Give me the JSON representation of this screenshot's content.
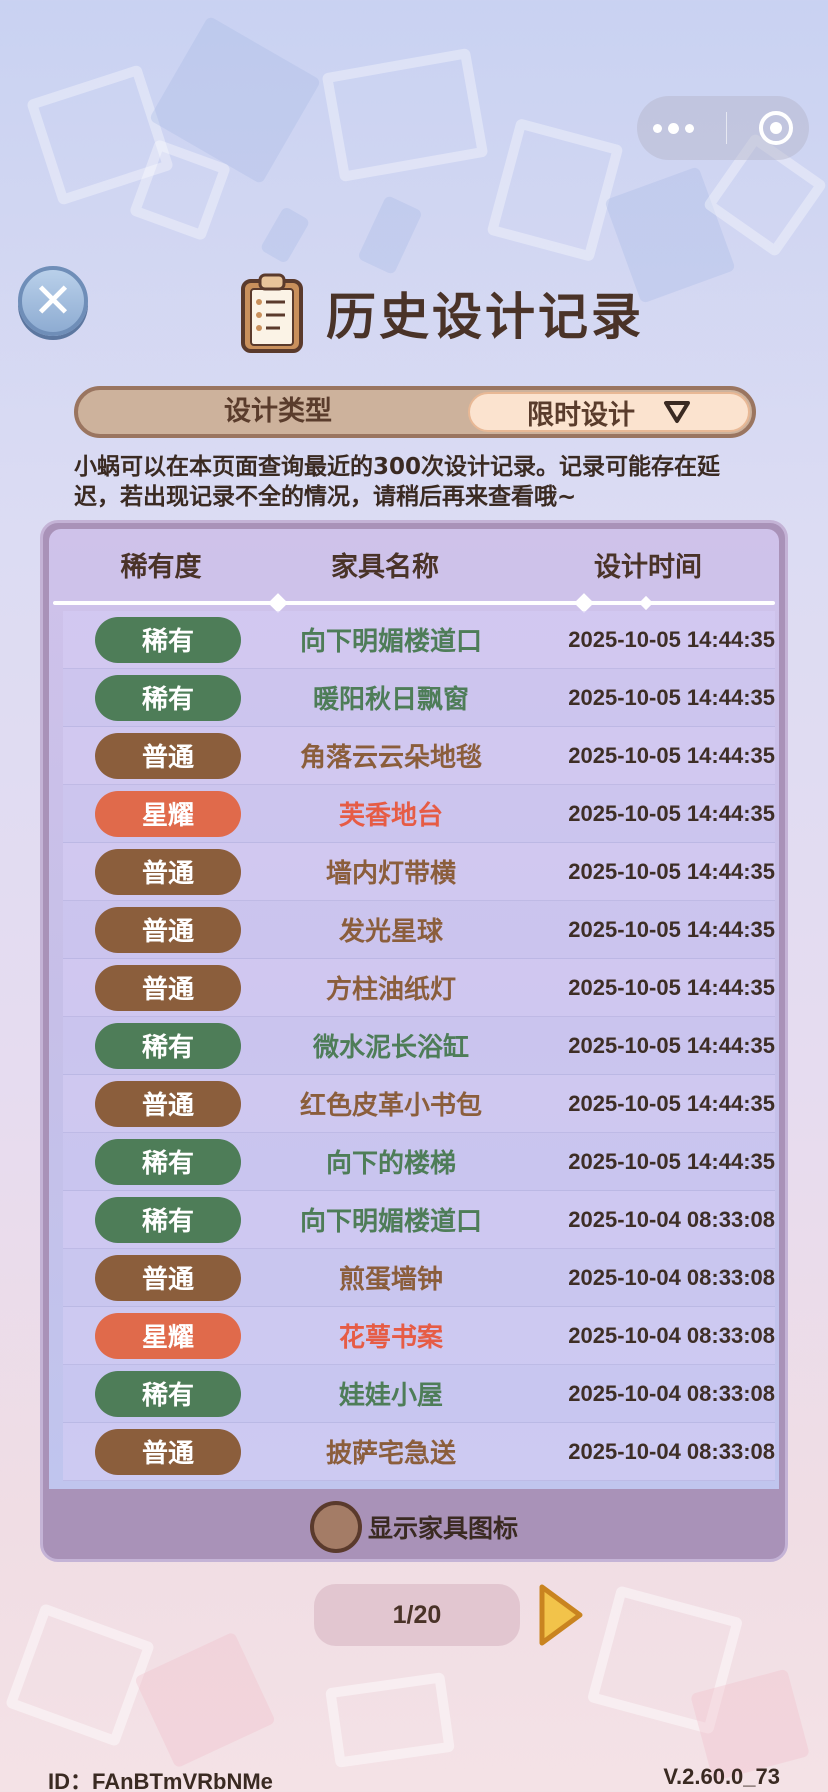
{
  "page": {
    "title": "历史设计记录",
    "type_label": "设计类型",
    "type_selected": "限时设计",
    "notice": "小蜗可以在本页面查询最近的300次设计记录。记录可能存在延迟，若出现记录不全的情况，请稍后再来查看哦~"
  },
  "table": {
    "headers": {
      "rarity": "稀有度",
      "name": "家具名称",
      "time": "设计时间"
    },
    "rows": [
      {
        "rarity": "稀有",
        "tier": "rare",
        "name": "向下明媚楼道口",
        "time": "2025-10-05 14:44:35"
      },
      {
        "rarity": "稀有",
        "tier": "rare",
        "name": "暖阳秋日飘窗",
        "time": "2025-10-05 14:44:35"
      },
      {
        "rarity": "普通",
        "tier": "common",
        "name": "角落云云朵地毯",
        "time": "2025-10-05 14:44:35"
      },
      {
        "rarity": "星耀",
        "tier": "star",
        "name": "芙香地台",
        "time": "2025-10-05 14:44:35"
      },
      {
        "rarity": "普通",
        "tier": "common",
        "name": "墙内灯带横",
        "time": "2025-10-05 14:44:35"
      },
      {
        "rarity": "普通",
        "tier": "common",
        "name": "发光星球",
        "time": "2025-10-05 14:44:35"
      },
      {
        "rarity": "普通",
        "tier": "common",
        "name": "方柱油纸灯",
        "time": "2025-10-05 14:44:35"
      },
      {
        "rarity": "稀有",
        "tier": "rare",
        "name": "微水泥长浴缸",
        "time": "2025-10-05 14:44:35"
      },
      {
        "rarity": "普通",
        "tier": "common",
        "name": "红色皮革小书包",
        "time": "2025-10-05 14:44:35"
      },
      {
        "rarity": "稀有",
        "tier": "rare",
        "name": "向下的楼梯",
        "time": "2025-10-05 14:44:35"
      },
      {
        "rarity": "稀有",
        "tier": "rare",
        "name": "向下明媚楼道口",
        "time": "2025-10-04 08:33:08"
      },
      {
        "rarity": "普通",
        "tier": "common",
        "name": "煎蛋墙钟",
        "time": "2025-10-04 08:33:08"
      },
      {
        "rarity": "星耀",
        "tier": "star",
        "name": "花萼书案",
        "time": "2025-10-04 08:33:08"
      },
      {
        "rarity": "稀有",
        "tier": "rare",
        "name": "娃娃小屋",
        "time": "2025-10-04 08:33:08"
      },
      {
        "rarity": "普通",
        "tier": "common",
        "name": "披萨宅急送",
        "time": "2025-10-04 08:33:08"
      }
    ]
  },
  "footer": {
    "toggle_label": "显示家具图标",
    "toggle_on": false,
    "page_indicator": "1/20"
  },
  "bottom": {
    "id_text": "ID：FAnBTmVRbNMe",
    "version": "V.2.60.0_73"
  },
  "icons": {
    "close": "close-icon",
    "clipboard": "clipboard-icon",
    "dropdown": "dropdown-triangle-icon",
    "next": "next-arrow-icon",
    "more": "more-dots-icon",
    "target": "target-icon"
  },
  "colors": {
    "rare": "#4e7d58",
    "common": "#8b5e3c",
    "star": "#e06a4b"
  }
}
